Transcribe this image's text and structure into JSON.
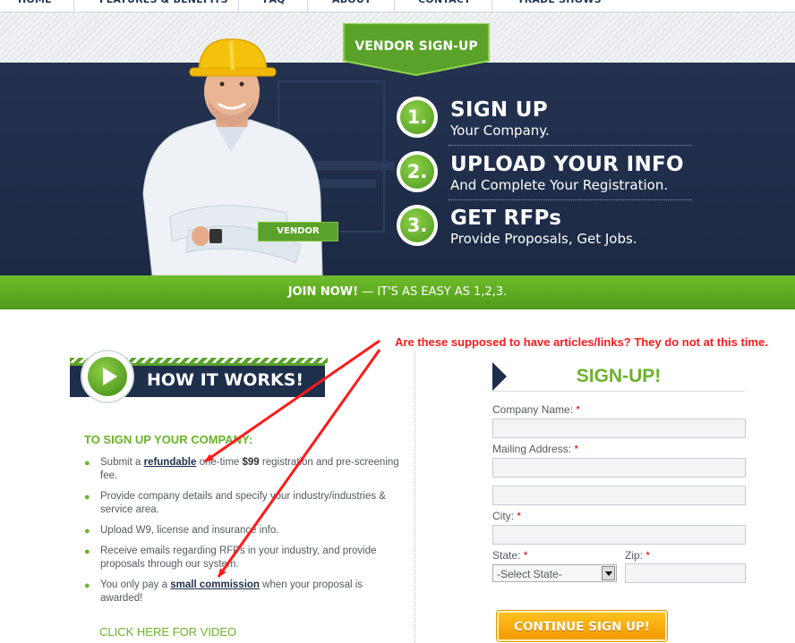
{
  "nav": {
    "items": [
      "HOME",
      "FEATURES & BENEFITS",
      "FAQ",
      "ABOUT",
      "CONTACT",
      "TRADE SHOWS"
    ]
  },
  "hero": {
    "tab_label": "VENDOR SIGN-UP",
    "badge": "VENDOR",
    "steps": [
      {
        "number": "1.",
        "title": "SIGN UP",
        "subtitle": "Your Company."
      },
      {
        "number": "2.",
        "title": "UPLOAD YOUR INFO",
        "subtitle": "And Complete Your Registration."
      },
      {
        "number": "3.",
        "title": "GET RFPs",
        "subtitle": "Provide Proposals, Get Jobs."
      }
    ],
    "join_bold": "JOIN NOW!",
    "join_rest": " — IT'S AS EASY AS 1,2,3."
  },
  "how_it_works": {
    "banner": "HOW IT WORKS!",
    "heading": "TO SIGN UP YOUR COMPANY:",
    "bullets": [
      {
        "pre": "Submit a ",
        "link": "refundable",
        "mid": " one-time ",
        "bold": "$99",
        "post": " registration and pre-screening fee."
      },
      {
        "text": "Provide company details and specify your industry/industries & service area."
      },
      {
        "text": "Upload W9, license and insurance info."
      },
      {
        "text": "Receive emails regarding RFPs in your industry, and provide proposals through our system."
      },
      {
        "pre": "You only pay a ",
        "link": "small commission",
        "post": " when your proposal is awarded!"
      }
    ],
    "video_link": "CLICK HERE FOR VIDEO"
  },
  "form": {
    "title": "SIGN-UP!",
    "required_mark": "*",
    "company_label": "Company Name:",
    "address_label": "Mailing Address:",
    "city_label": "City:",
    "state_label": "State:",
    "zip_label": "Zip:",
    "state_value": "-Select State-",
    "continue_label": "CONTINUE SIGN UP!"
  },
  "annotation": {
    "text": "Are these supposed to have articles/links?  They do not at this time.",
    "color": "#ff1a1a"
  },
  "colors": {
    "navy": "#1e2f4b",
    "green": "#6ab32a",
    "orange": "#f29a00"
  }
}
